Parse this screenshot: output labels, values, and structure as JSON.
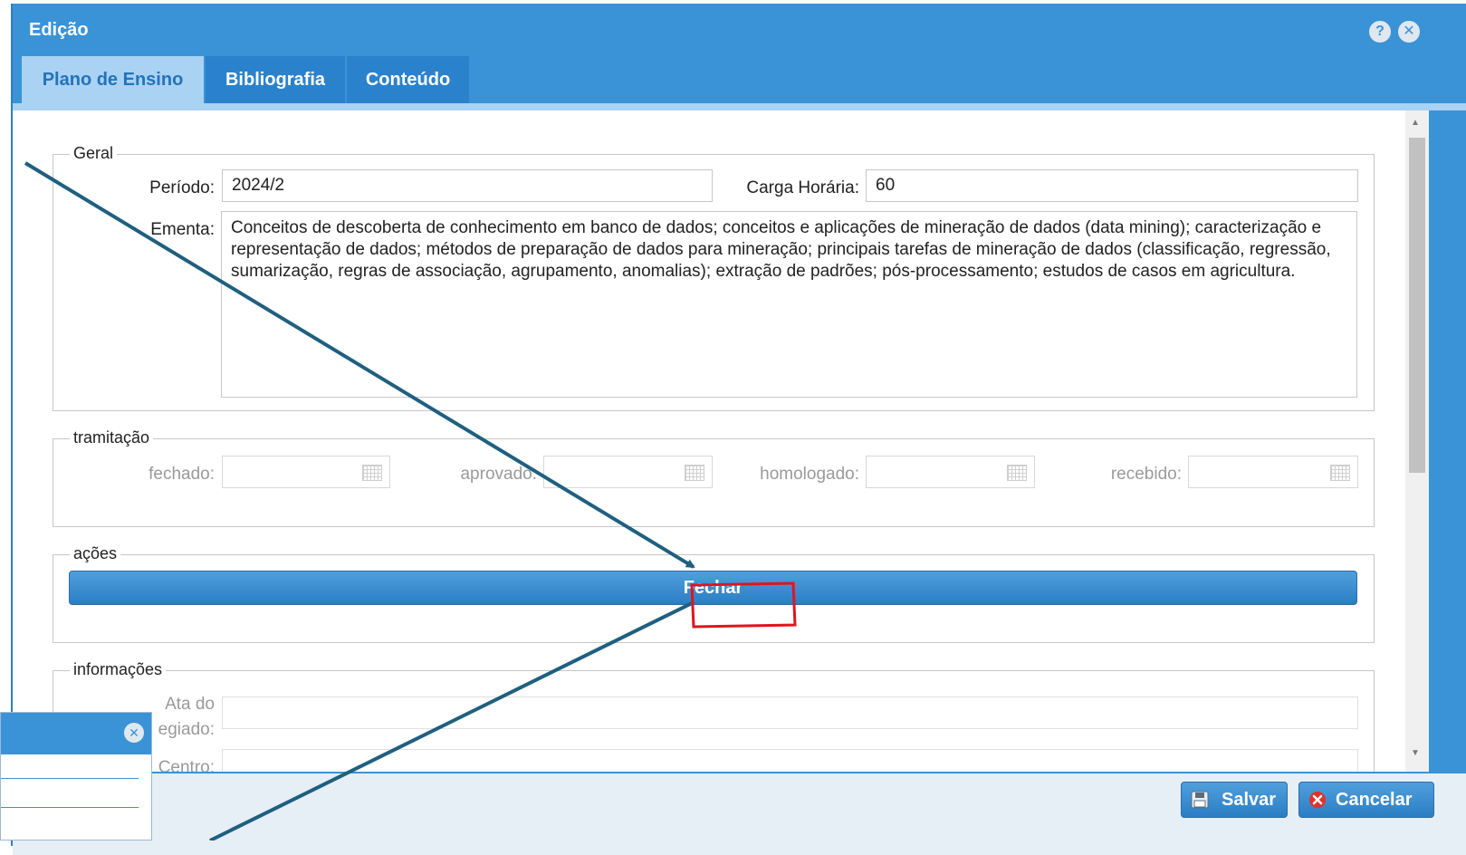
{
  "window": {
    "title": "Edição"
  },
  "tabs": [
    {
      "label": "Plano de Ensino",
      "active": true
    },
    {
      "label": "Bibliografia",
      "active": false
    },
    {
      "label": "Conteúdo",
      "active": false
    }
  ],
  "geral": {
    "legend": "Geral",
    "periodo_label": "Período:",
    "periodo_value": "2024/2",
    "carga_label": "Carga Horária:",
    "carga_value": "60",
    "ementa_label": "Ementa:",
    "ementa_text": "Conceitos de descoberta de conhecimento em banco de dados; conceitos e aplicações de mineração de dados (data mining); caracterização e representação de dados; métodos de preparação de dados para mineração; principais tarefas de mineração de dados (classificação, regressão, sumarização, regras de associação, agrupamento, anomalias); extração de padrões; pós-processamento; estudos de casos em agricultura."
  },
  "tramitacao": {
    "legend": "tramitação",
    "fechado_label": "fechado:",
    "aprovado_label": "aprovado:",
    "homologado_label": "homologado:",
    "recebido_label": "recebido:"
  },
  "acoes": {
    "legend": "ações",
    "fechar_label": "Fechar"
  },
  "informacoes": {
    "legend": "informações",
    "ata_label_line1": "Ata do",
    "ata_label_line2": "egiado:",
    "centro_label": "Centro:"
  },
  "footer": {
    "salvar_label": "Salvar",
    "cancelar_label": "Cancelar"
  },
  "colors": {
    "primary": "#3a93d6",
    "annotation_arrow": "#1f5f80",
    "highlight_box": "#e0141e"
  },
  "icons": [
    "help-icon",
    "close-icon",
    "calendar-icon",
    "save-icon",
    "cancel-icon"
  ]
}
